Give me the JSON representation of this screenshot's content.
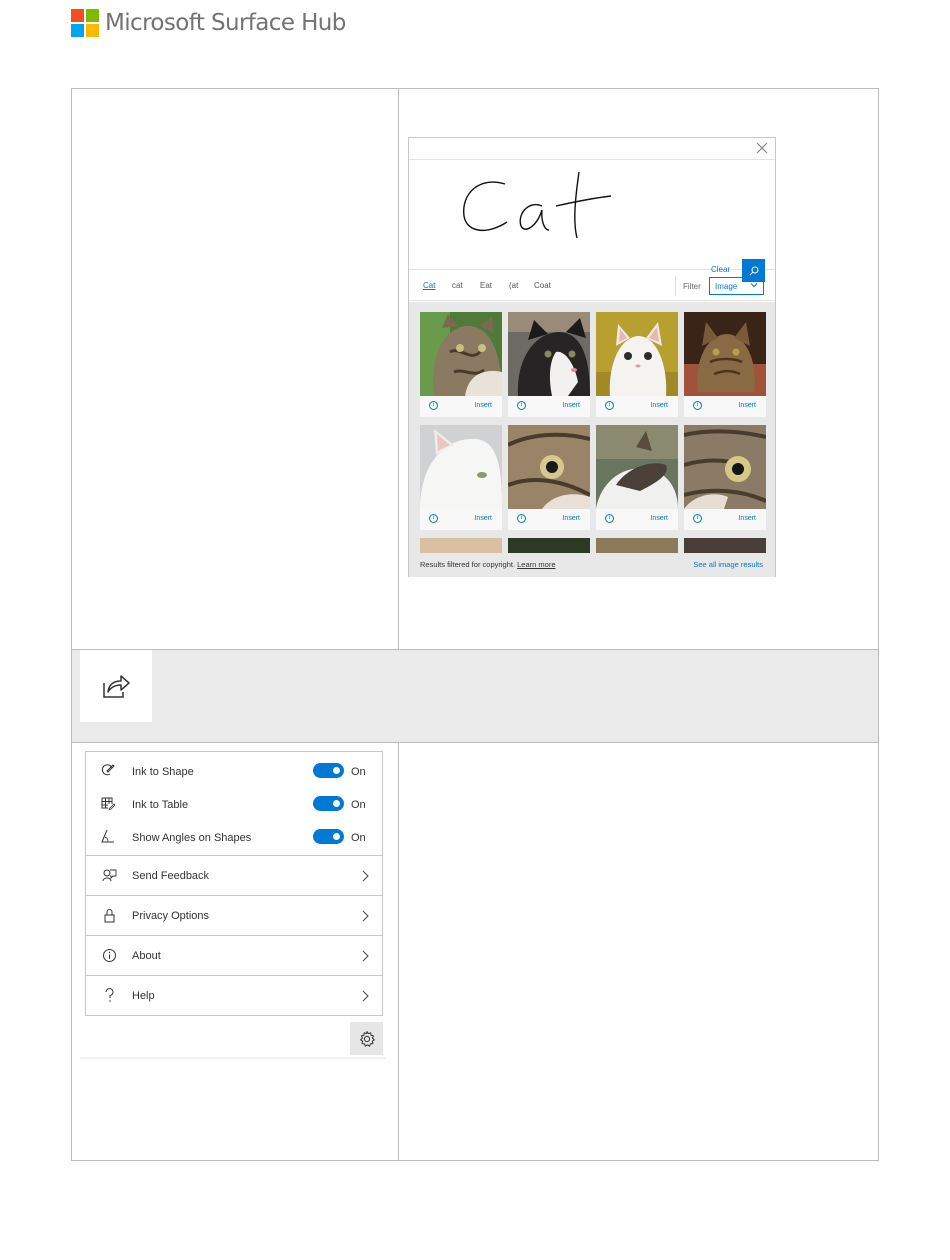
{
  "header": {
    "logo_text": "Microsoft Surface Hub",
    "logo_colors": [
      "#f25022",
      "#7fba00",
      "#00a4ef",
      "#ffb900"
    ]
  },
  "ink_search": {
    "handwritten_text": "Cat",
    "clear_label": "Clear",
    "suggestions": [
      "Cat",
      "cat",
      "Eat",
      "(at",
      "Coat"
    ],
    "active_suggestion": "Cat",
    "filter_label": "Filter",
    "filter_value": "Image",
    "info_glyph": "i",
    "insert_label": "Insert",
    "footer_text": "Results filtered for copyright.",
    "footer_link": "Learn more",
    "see_all_label": "See all image results",
    "accent_color": "#0078d4"
  },
  "settings_menu": {
    "toggles": [
      {
        "label": "Ink to Shape",
        "state": "On",
        "icon": "ink-to-shape-icon"
      },
      {
        "label": "Ink to Table",
        "state": "On",
        "icon": "ink-to-table-icon"
      },
      {
        "label": "Show Angles on Shapes",
        "state": "On",
        "icon": "angle-icon"
      }
    ],
    "nav_items": [
      {
        "label": "Send Feedback",
        "icon": "feedback-icon"
      },
      {
        "label": "Privacy Options",
        "icon": "lock-icon"
      },
      {
        "label": "About",
        "icon": "info-icon"
      },
      {
        "label": "Help",
        "icon": "question-icon"
      }
    ]
  },
  "icons": {
    "share": "share-icon",
    "gear": "gear-icon",
    "close": "close-icon",
    "search": "search-icon"
  }
}
